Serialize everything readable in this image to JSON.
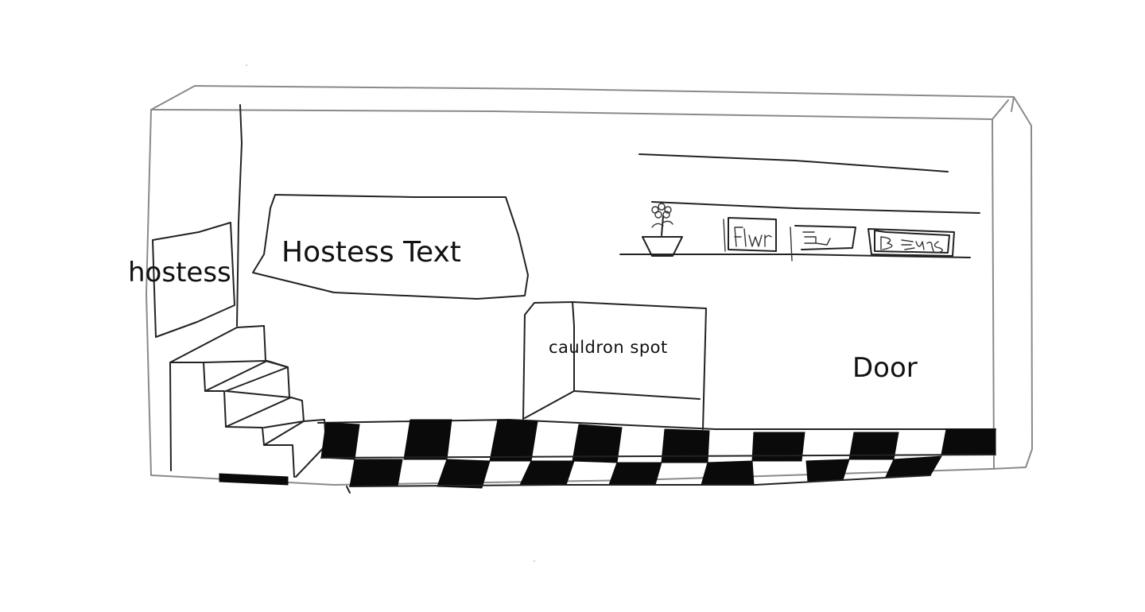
{
  "labels": {
    "hostess": "hostess",
    "hostess_text": "Hostess Text",
    "cauldron_spot": "cauldron spot",
    "door": "Door"
  },
  "colors": {
    "ink": "#222222",
    "outer_frame": "#8a8a8a",
    "floor_dark": "#0a0a0a",
    "background": "#ffffff"
  },
  "icons": [
    "flower-pot-icon",
    "shelf-item-flwr-icon",
    "shelf-item-box-icon",
    "shelf-item-bears-icon"
  ]
}
